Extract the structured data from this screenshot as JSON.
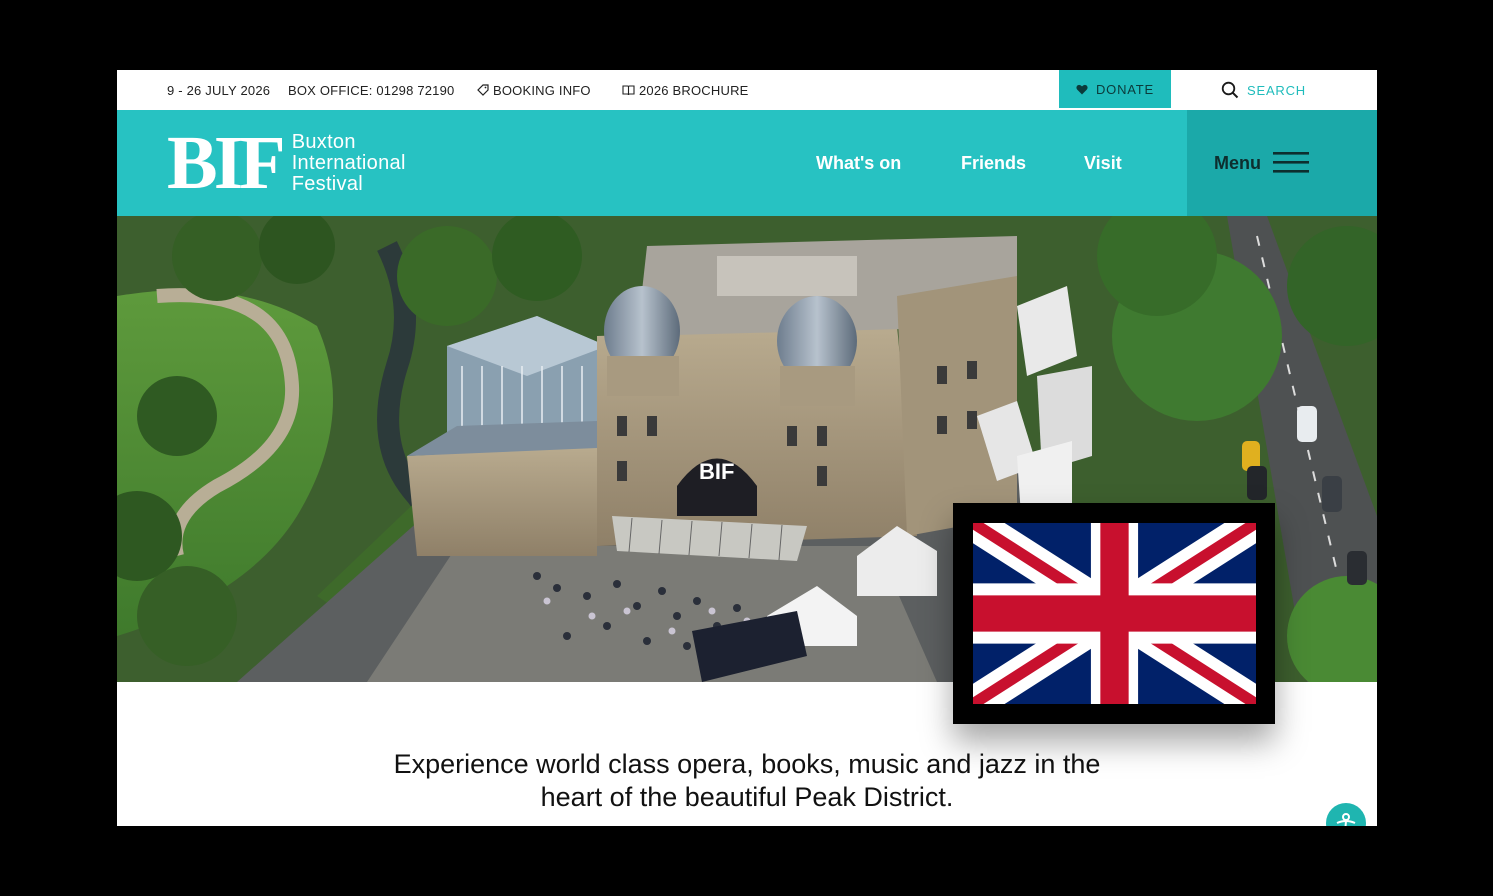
{
  "topbar": {
    "dates": "9 - 26 JULY 2026",
    "box_office": "BOX OFFICE: 01298 72190",
    "booking_info": "BOOKING INFO",
    "brochure": "2026 BROCHURE",
    "donate": "DONATE",
    "search": "SEARCH"
  },
  "header": {
    "logo_mark": "BIF",
    "logo_line1": "Buxton",
    "logo_line2": "International",
    "logo_line3": "Festival",
    "nav": [
      "What's on",
      "Friends",
      "Visit"
    ],
    "menu_label": "Menu"
  },
  "hero": {
    "sign_text": "BIF"
  },
  "intro": {
    "text": "Experience world class opera, books, music and jazz in the heart of the beautiful Peak District."
  },
  "colors": {
    "accent": "#27c2c2",
    "accent_dark": "#1ba9a9",
    "donate_bg": "#1fbcbc"
  },
  "icons": {
    "donate": "heart-icon",
    "booking": "tag-icon",
    "brochure": "book-icon",
    "search": "search-icon",
    "menu": "hamburger-icon",
    "accessibility": "accessibility-icon"
  }
}
